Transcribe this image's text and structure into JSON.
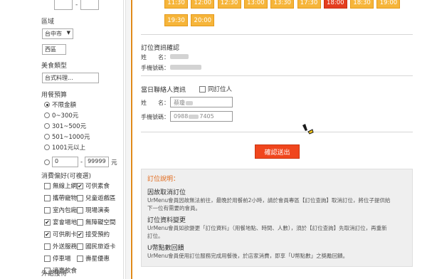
{
  "sidebar": {
    "top_dash": "-",
    "region_label": "區域",
    "city_value": "台中市",
    "district_value": "西區",
    "cuisine_label": "美食類型",
    "cuisine_value": "台式料理...",
    "budget_label": "用餐預算",
    "budget_options": [
      "不限金額",
      "0~300元",
      "301~500元",
      "501~1000元",
      "1001元以上"
    ],
    "budget_selected_index": 0,
    "custom_min": "0",
    "custom_max": "99999",
    "custom_dash": "-",
    "custom_unit": "元",
    "prefs_label": "消費偏好(可複選)",
    "prefs": [
      {
        "label": "無線上網",
        "checked": false
      },
      {
        "label": "可供素食",
        "checked": true
      },
      {
        "label": "攜帶寵物",
        "checked": false
      },
      {
        "label": "兒童遊戲區",
        "checked": false
      },
      {
        "label": "室內包廂",
        "checked": false
      },
      {
        "label": "現場演奏",
        "checked": false
      },
      {
        "label": "宴會場地",
        "checked": true
      },
      {
        "label": "無障礙空間",
        "checked": false
      },
      {
        "label": "可供刷卡",
        "checked": true
      },
      {
        "label": "接受預約",
        "checked": true
      },
      {
        "label": "外送服務",
        "checked": false
      },
      {
        "label": "國民旅遊卡",
        "checked": false
      },
      {
        "label": "停車場",
        "checked": false
      },
      {
        "label": "壽星優惠",
        "checked": false
      },
      {
        "label": "適賣飲食",
        "checked": false
      }
    ],
    "bottom_label": "外語接待"
  },
  "timeslots_row1": [
    "11:30",
    "12:00",
    "12:30",
    "13:00",
    "13:30",
    "17:30",
    "18:00",
    "18:30",
    "19:00"
  ],
  "timeslots_row2": [
    "19:30",
    "20:00"
  ],
  "selected_slot": "18:00",
  "booking": {
    "heading": "訂位資訊確認",
    "name_label": "姓　　名：",
    "phone_label": "手機號碼："
  },
  "contact": {
    "heading": "當日聯絡人資訊",
    "same_as_label": "同訂位人",
    "name_label": "姓　　名：",
    "name_value": "蔡瓊",
    "phone_label": "手機號碼：",
    "phone_value": "0988",
    "phone_value_end": "7405"
  },
  "confirm_label": "確認送出",
  "notice": {
    "title": "訂位說明：",
    "sections": [
      {
        "title": "因故取消訂位",
        "body": [
          "UrMenu會員因故無法前往，最晚於用餐前2小時，請於會員專區【訂位查詢】取消訂位，將位子提供給",
          "下一位有需要的會員。"
        ]
      },
      {
        "title": "訂位資料變更",
        "body": [
          "UrMenu會員如欲變更「訂位資料」（用餐地點、時間、人數），須於【訂位查詢】先取消訂位，再重新",
          "訂位。"
        ]
      },
      {
        "title": "U幣點數回饋",
        "body": [
          "UrMenu會員使用訂位服務完成用餐後，於店家消費，即享「U幣點數」之獎勵回饋。"
        ]
      }
    ]
  },
  "colors": {
    "slot": "#f6b53a",
    "slot_selected": "#e43d1f",
    "confirm": "#f0461d",
    "accent_border": "#e08a1a",
    "notice_title": "#e26a1b"
  }
}
